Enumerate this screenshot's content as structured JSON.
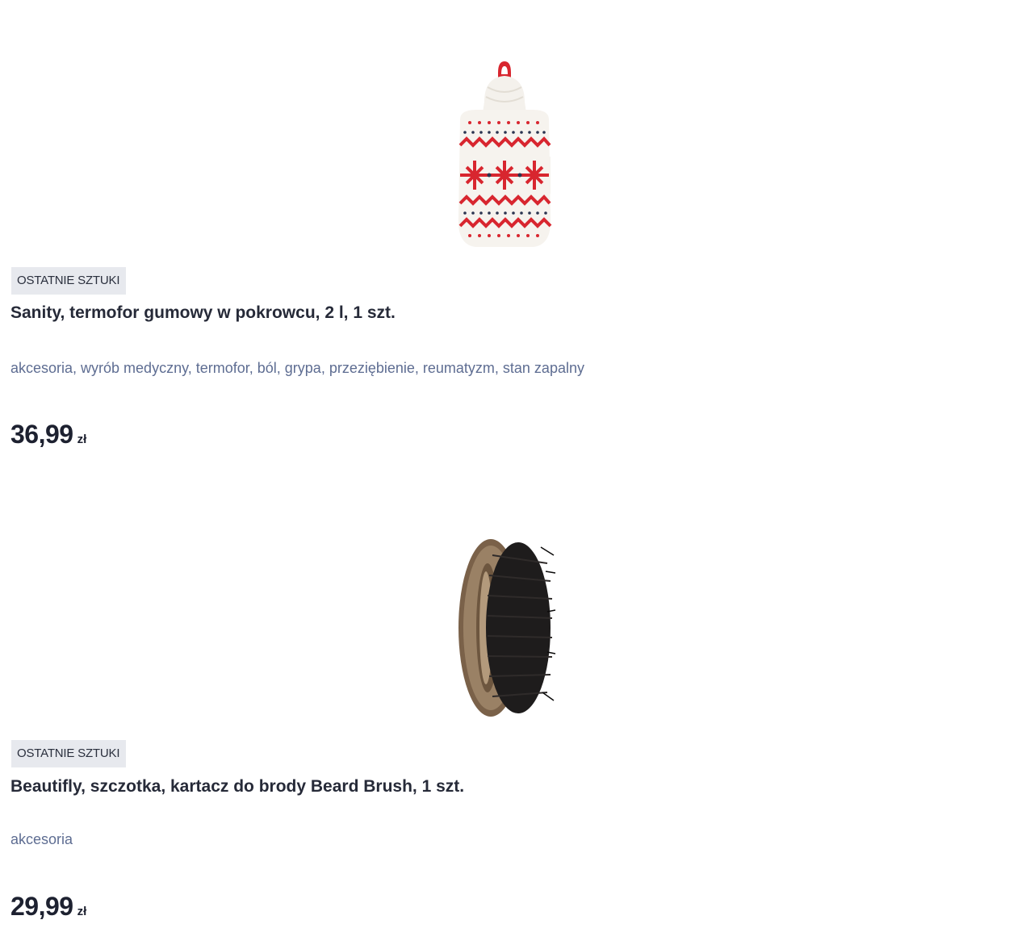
{
  "products": [
    {
      "badge": "OSTATNIE SZTUKI",
      "title": "Sanity, termofor gumowy w pokrowcu, 2 l, 1 szt.",
      "tags": "akcesoria, wyrób medyczny, termofor, ból, grypa, przeziębienie, reumatyzm, stan zapalny",
      "price_value": "36,99",
      "price_currency": "zł",
      "image_icon": "hot-water-bottle-icon"
    },
    {
      "badge": "OSTATNIE SZTUKI",
      "title": "Beautifly, szczotka, kartacz do brody Beard Brush, 1 szt.",
      "tags": "akcesoria",
      "price_value": "29,99",
      "price_currency": "zł",
      "image_icon": "beard-brush-icon"
    }
  ],
  "colors": {
    "badge_bg": "#e7e9ee",
    "tag_text": "#5e6d92",
    "pattern_red": "#d8262f"
  }
}
